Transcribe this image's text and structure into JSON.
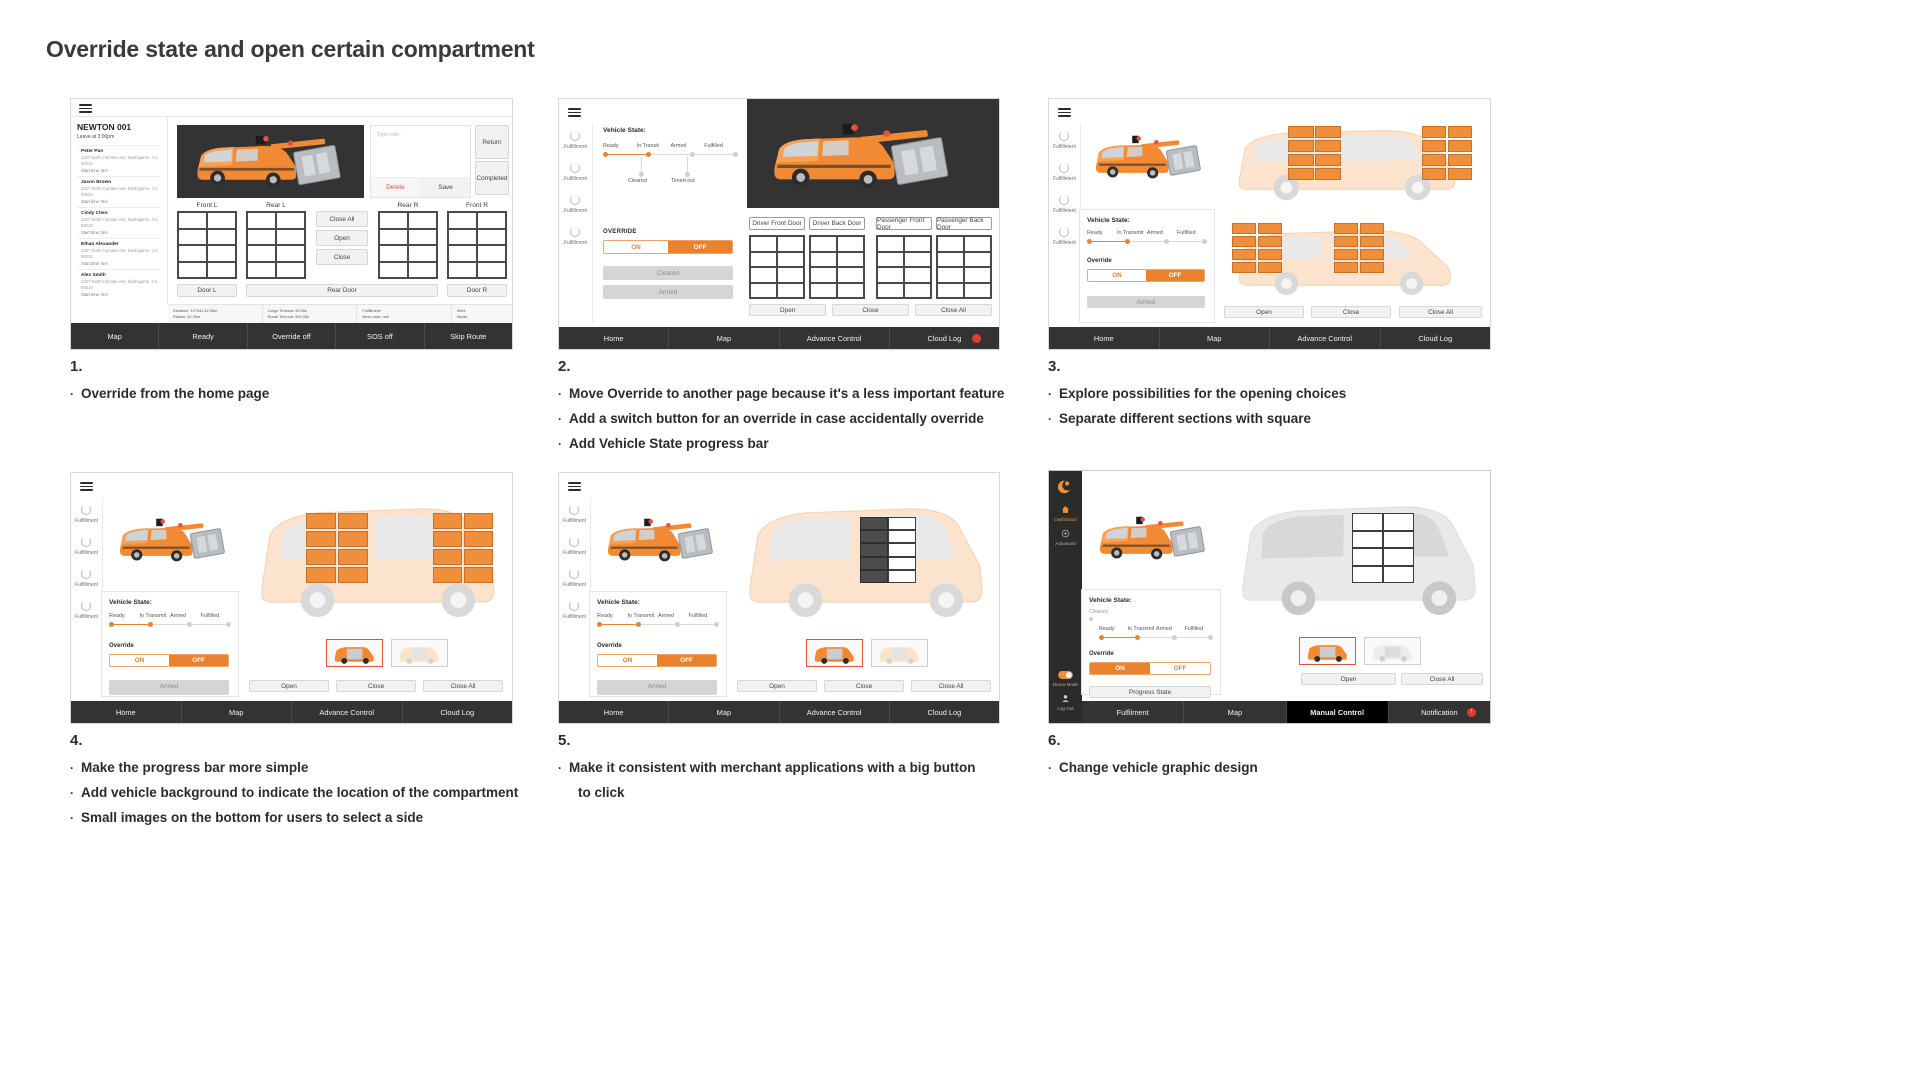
{
  "page": {
    "title": "Override state and open certain compartment"
  },
  "panel1": {
    "route": {
      "name": "NEWTON 001",
      "leave": "Leave at 3:00pm"
    },
    "stops": [
      {
        "name": "Peter Pan",
        "address": "1327 North Carolan Ave, Burlingame, CA, 94010",
        "start": "Start time: N/A"
      },
      {
        "name": "Jason Brown",
        "address": "1327 North Carolan Ave, Burlingame, CA, 94010",
        "start": "Start time: N/A"
      },
      {
        "name": "Cindy Chen",
        "address": "1327 North Carolan Ave, Burlingame, CA, 94010",
        "start": "Start time: N/A"
      },
      {
        "name": "Ethan Alexander",
        "address": "1327 North Carolan Ave, Burlingame, CA, 94010",
        "start": "Start time: N/A"
      },
      {
        "name": "Alex Smith",
        "address": "1327 North Carolan Ave, Burlingame, CA, 94010",
        "start": "Start time: N/A"
      }
    ],
    "note": {
      "placeholder": "Type note...",
      "delete": "Delete",
      "save": "Save"
    },
    "side_buttons": {
      "return": "Return",
      "completed": "Completed"
    },
    "compartment_labels": {
      "front_l": "Front L",
      "rear_l": "Rear L",
      "rear_r": "Rear R",
      "front_r": "Front R"
    },
    "door_buttons": {
      "door_l": "Door L",
      "rear_door": "Rear Door",
      "door_r": "Door R"
    },
    "center_buttons": {
      "close_all": "Close All",
      "open": "Open",
      "close": "Close"
    },
    "status": [
      {
        "l1": "Distance: 127942.42.28m",
        "l2": "Radius: 40.30m"
      },
      {
        "l1": "Cargo Timeout: 90.00s",
        "l2": "Route Timeout: 900.00s"
      },
      {
        "l1": "Fulfillment:",
        "l2": "Next route: null"
      },
      {
        "l1": "Alert:",
        "l2": "Mode:"
      }
    ],
    "nav": [
      "Map",
      "Ready",
      "Override off",
      "SOS off",
      "Skip Route"
    ]
  },
  "panel2": {
    "sidebar_items": [
      "Fulfillment",
      "Fulfillment",
      "Fulfillment",
      "Fulfillment"
    ],
    "vehicle_state_title": "Vehicle State:",
    "states_top": [
      "Ready",
      "In Transit",
      "Armed",
      "Fulfilled"
    ],
    "states_bottom": [
      "Cleared",
      "Timed out"
    ],
    "override_title": "OVERRIDE",
    "toggle": {
      "on": "ON",
      "off": "OFF"
    },
    "action_buttons": [
      "Cleared",
      "Armed"
    ],
    "door_tabs": [
      "Driver Front Door",
      "Driver Back Door",
      "Passenger Front Door",
      "Passenger Back Door"
    ],
    "grid_buttons": [
      "Open",
      "Close",
      "Close All"
    ],
    "nav": [
      "Home",
      "Map",
      "Advance Control",
      "Cloud Log"
    ]
  },
  "panel3": {
    "sidebar_items": [
      "Fulfillment",
      "Fulfillment",
      "Fulfillment",
      "Fulfillment"
    ],
    "vehicle_state_title": "Vehicle State:",
    "states": [
      "Ready",
      "In Transmit",
      "Armed",
      "Fulfilled"
    ],
    "override_title": "Override",
    "toggle": {
      "on": "ON",
      "off": "OFF"
    },
    "armed_button": "Armed",
    "buttons": [
      "Open",
      "Close",
      "Close All"
    ],
    "nav": [
      "Home",
      "Map",
      "Advance Control",
      "Cloud Log"
    ]
  },
  "panel4": {
    "sidebar_items": [
      "Fulfillment",
      "Fulfillment",
      "Fulfillment",
      "Fulfillment"
    ],
    "vehicle_state_title": "Vehicle State:",
    "states": [
      "Ready",
      "In Transmit",
      "Armed",
      "Fulfilled"
    ],
    "override_title": "Override",
    "toggle": {
      "on": "ON",
      "off": "OFF"
    },
    "armed_button": "Armed",
    "buttons": [
      "Open",
      "Close",
      "Close All"
    ],
    "nav": [
      "Home",
      "Map",
      "Advance Control",
      "Cloud Log"
    ]
  },
  "panel5": {
    "sidebar_items": [
      "Fulfillment",
      "Fulfillment",
      "Fulfillment",
      "Fulfillment"
    ],
    "vehicle_state_title": "Vehicle State:",
    "states": [
      "Ready",
      "In Transmit",
      "Armed",
      "Fulfilled"
    ],
    "override_title": "Override",
    "toggle": {
      "on": "ON",
      "off": "OFF"
    },
    "armed_button": "Armed",
    "buttons": [
      "Open",
      "Close",
      "Close All"
    ],
    "nav": [
      "Home",
      "Map",
      "Advance Control",
      "Cloud Log"
    ]
  },
  "panel6": {
    "sidebar_items": [
      {
        "label": "Dashboard",
        "icon": "home-icon"
      },
      {
        "label": "Advanced",
        "icon": "gear-icon"
      }
    ],
    "sidebar_bottom": [
      {
        "label": "Demo Mode",
        "icon": "toggle-icon"
      },
      {
        "label": "Log Out",
        "icon": "user-icon"
      }
    ],
    "vehicle_state_title": "Vehicle State:",
    "states": [
      "Ready",
      "In Transmit",
      "Armed",
      "Fulfilled"
    ],
    "cleared_label": "Cleared",
    "override_title": "Override",
    "toggle": {
      "on": "ON",
      "off": "OFF"
    },
    "progress_button": "Progress State",
    "buttons": [
      "Open",
      "Close All"
    ],
    "nav": [
      "Fulfilment",
      "Map",
      "Manual Control",
      "Notification"
    ],
    "notification_badge": "!"
  },
  "captions": [
    {
      "num": "1.",
      "items": [
        "Override from the home page"
      ]
    },
    {
      "num": "2.",
      "items": [
        "Move Override to another page because it's a less important feature",
        "Add a switch button for an override in case accidentally override",
        "Add Vehicle State progress bar"
      ]
    },
    {
      "num": "3.",
      "items": [
        "Explore possibilities for the opening choices",
        "Separate different sections with square"
      ]
    },
    {
      "num": "4.",
      "items": [
        "Make the progress bar more simple",
        "Add vehicle background to indicate the location of the compartment",
        "Small images on the bottom for users to select a side"
      ]
    },
    {
      "num": "5.",
      "items": [
        "Make it consistent with merchant applications with a big button",
        "to click"
      ]
    },
    {
      "num": "6.",
      "items": [
        "Change vehicle graphic design"
      ]
    }
  ],
  "colors": {
    "accent": "#e8822e",
    "dark": "#333333",
    "alert": "#e03b2f"
  }
}
